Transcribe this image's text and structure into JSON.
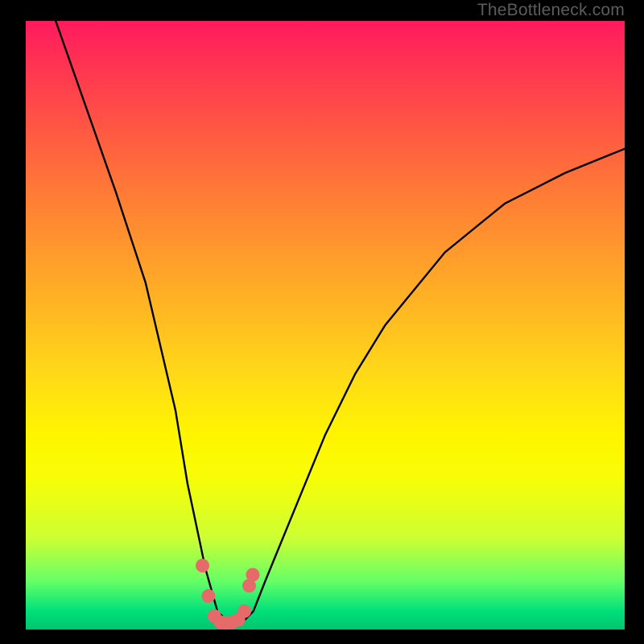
{
  "watermark": "TheBottleneck.com",
  "chart_data": {
    "type": "line",
    "title": "",
    "xlabel": "",
    "ylabel": "",
    "xlim": [
      0,
      100
    ],
    "ylim": [
      0,
      100
    ],
    "series": [
      {
        "name": "bottleneck-curve",
        "x": [
          5,
          10,
          15,
          20,
          25,
          27,
          30,
          32,
          34,
          36,
          38,
          40,
          45,
          50,
          55,
          60,
          65,
          70,
          75,
          80,
          85,
          90,
          95,
          100
        ],
        "values": [
          100,
          86,
          72,
          57,
          36,
          24,
          10,
          3,
          1,
          1,
          3,
          8,
          20,
          32,
          42,
          50,
          56,
          62,
          66,
          70,
          72.5,
          75,
          77,
          79
        ]
      }
    ],
    "markers": {
      "name": "highlighted-points",
      "x": [
        29.5,
        30.5,
        31.5,
        32.5,
        33.5,
        34.5,
        35.5,
        36.5,
        37.3,
        37.9
      ],
      "values": [
        10.5,
        5.5,
        2.2,
        1.2,
        1.0,
        1.2,
        1.6,
        3.0,
        7.2,
        9.0
      ]
    },
    "background_gradient": {
      "top": "#ff1a5e",
      "mid": "#fff500",
      "bottom": "#00c46e"
    }
  }
}
